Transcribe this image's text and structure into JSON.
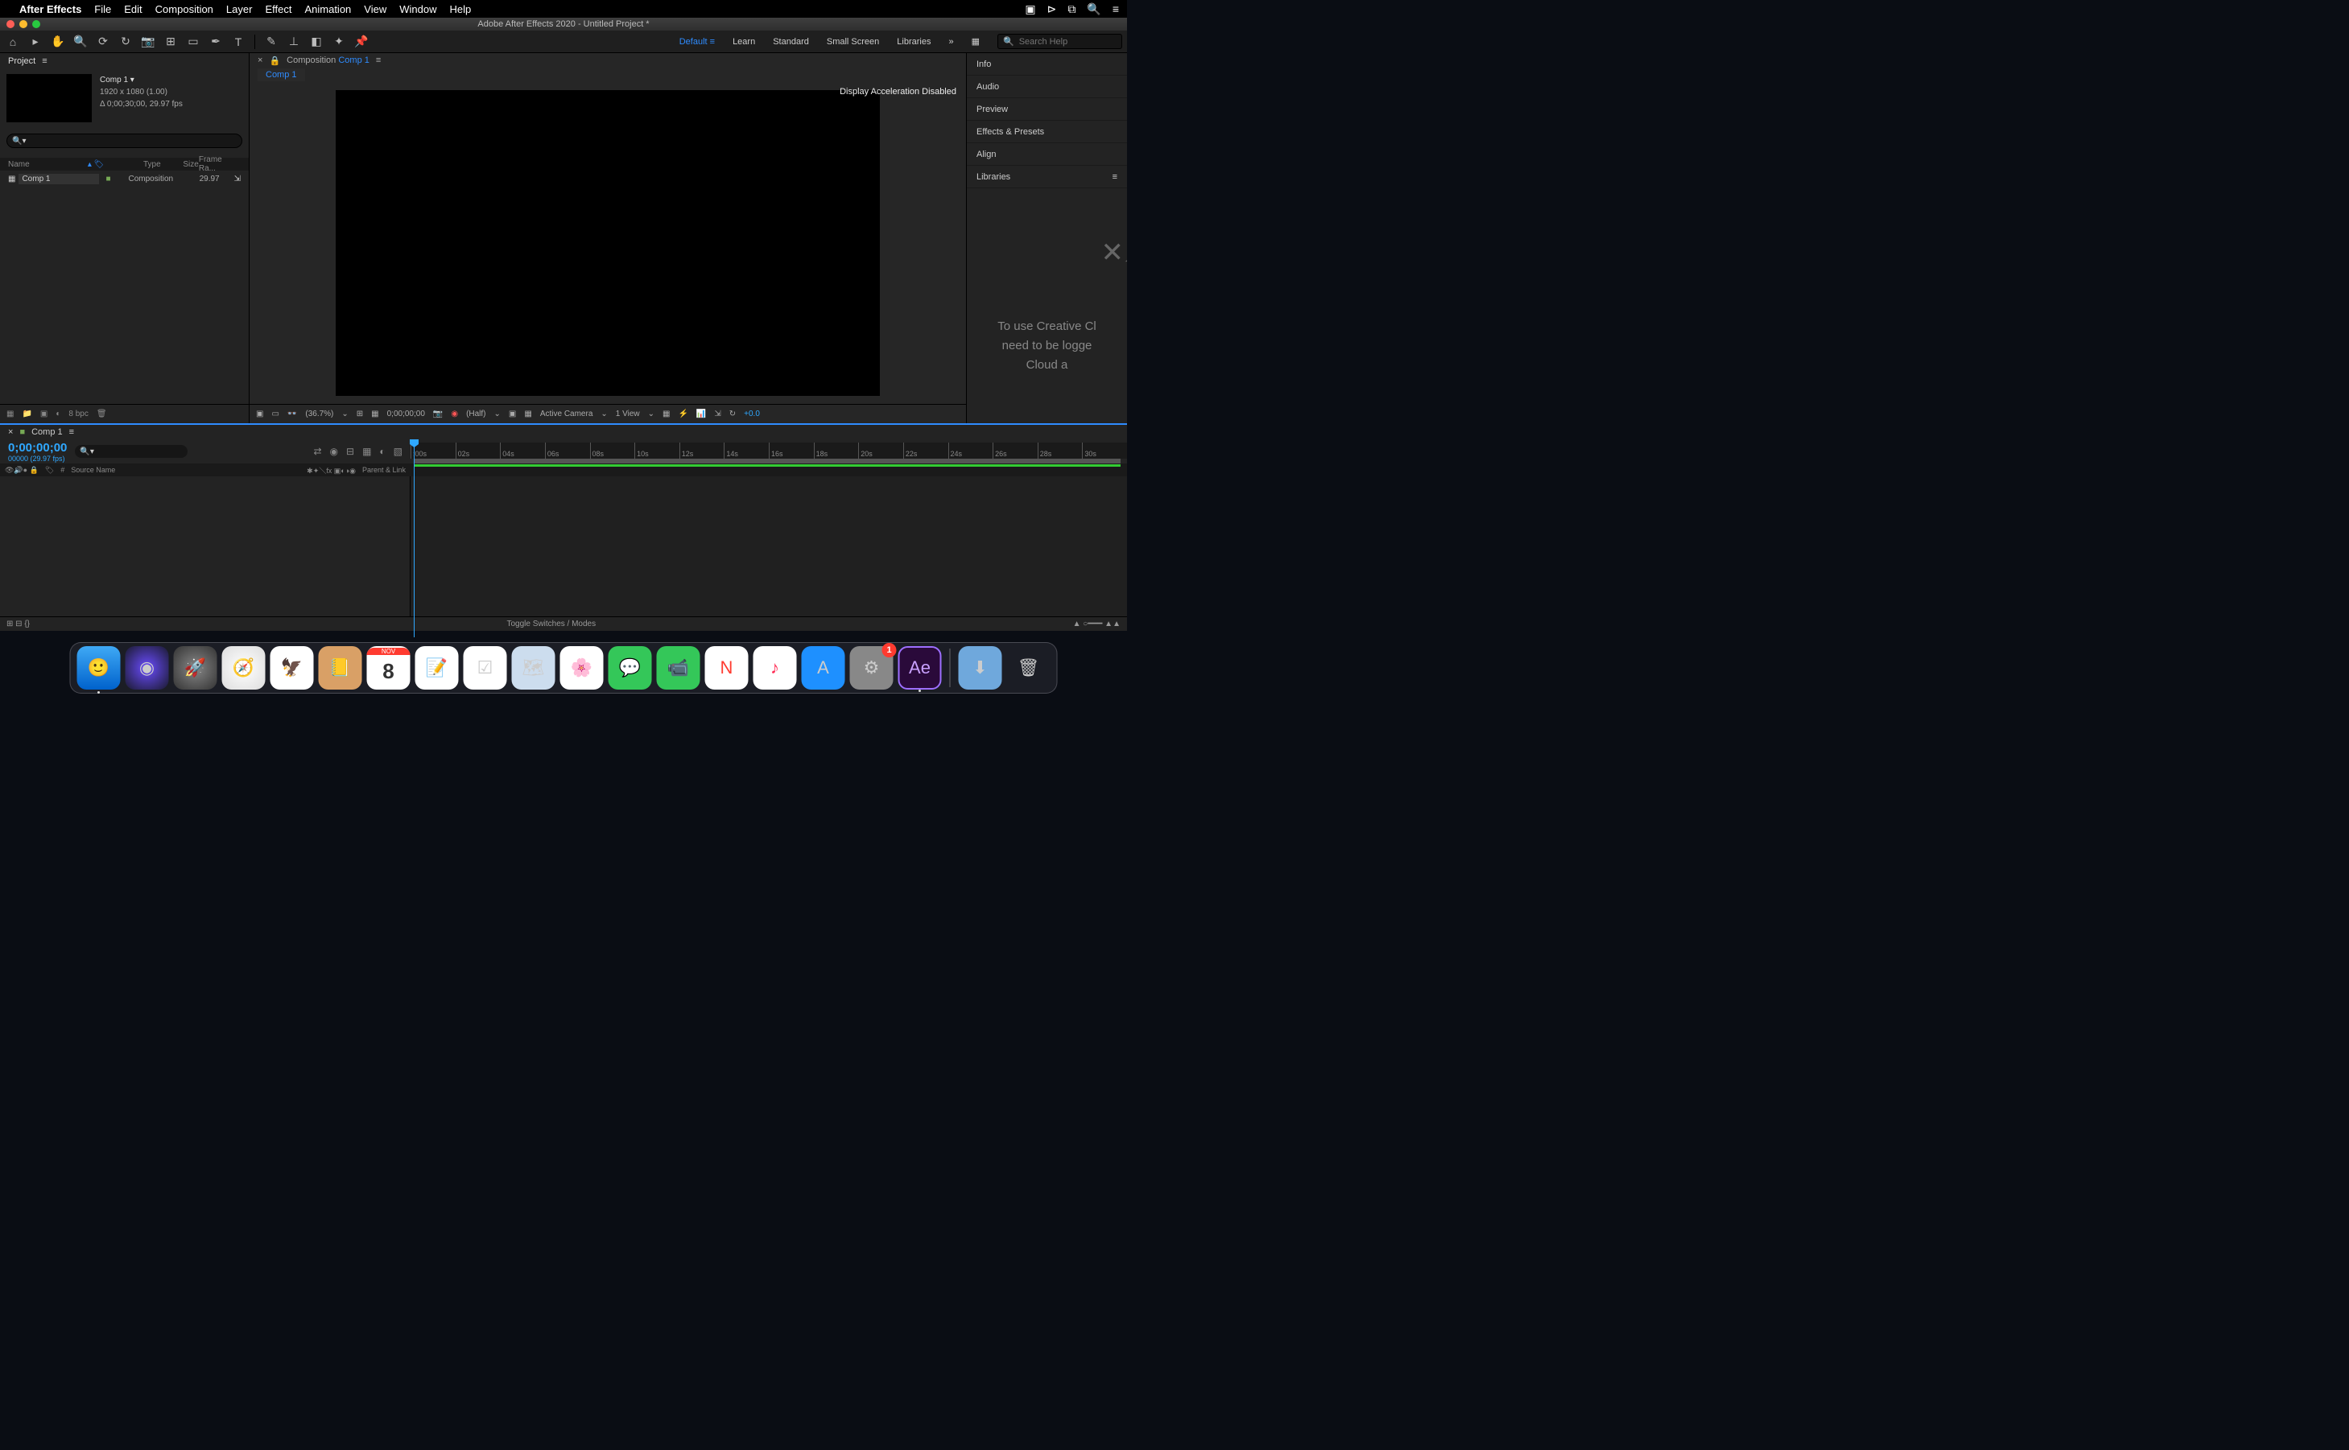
{
  "menubar": {
    "app": "After Effects",
    "items": [
      "File",
      "Edit",
      "Composition",
      "Layer",
      "Effect",
      "Animation",
      "View",
      "Window",
      "Help"
    ]
  },
  "window": {
    "title": "Adobe After Effects 2020 - Untitled Project *"
  },
  "workspaces": {
    "active": "Default",
    "items": [
      "Learn",
      "Standard",
      "Small Screen",
      "Libraries"
    ],
    "search_placeholder": "Search Help"
  },
  "project": {
    "panel_title": "Project",
    "comp_name": "Comp 1",
    "resolution": "1920 x 1080 (1.00)",
    "duration_fps": "Δ 0;00;30;00, 29.97 fps",
    "columns": {
      "name": "Name",
      "type": "Type",
      "size": "Size",
      "fr": "Frame Ra..."
    },
    "row": {
      "name": "Comp 1",
      "type": "Composition",
      "framerate": "29.97"
    },
    "footer_bpc": "8 bpc"
  },
  "composition": {
    "tab_prefix": "Composition",
    "tab_name": "Comp 1",
    "display_msg": "Display Acceleration Disabled",
    "zoom": "(36.7%)",
    "timecode": "0;00;00;00",
    "resolution_label": "(Half)",
    "camera": "Active Camera",
    "view": "1 View",
    "exposure": "+0.0"
  },
  "right_panels": [
    "Info",
    "Audio",
    "Preview",
    "Effects & Presets",
    "Align",
    "Libraries"
  ],
  "libraries_msg": [
    "To use Creative Cl",
    "need to be logge",
    "Cloud a"
  ],
  "timeline": {
    "tab": "Comp 1",
    "timecode": "0;00;00;00",
    "sub": "00000 (29.97 fps)",
    "cols": {
      "num": "#",
      "source": "Source Name",
      "parent": "Parent & Link"
    },
    "ticks": [
      ":00s",
      "02s",
      "04s",
      "06s",
      "08s",
      "10s",
      "12s",
      "14s",
      "16s",
      "18s",
      "20s",
      "22s",
      "24s",
      "26s",
      "28s",
      "30s"
    ],
    "footer": "Toggle Switches / Modes"
  },
  "dock": {
    "apps": [
      {
        "name": "finder",
        "bg": "linear-gradient(#3fa9f5,#0062cc)",
        "glyph": "🙂",
        "running": true
      },
      {
        "name": "siri",
        "bg": "radial-gradient(circle,#6a4cff,#1a1a2e)",
        "glyph": "◉"
      },
      {
        "name": "launchpad",
        "bg": "radial-gradient(circle,#888,#333)",
        "glyph": "🚀"
      },
      {
        "name": "safari",
        "bg": "radial-gradient(circle,#fff,#ddd)",
        "glyph": "🧭"
      },
      {
        "name": "mail",
        "bg": "#fff",
        "glyph": "🦅"
      },
      {
        "name": "contacts",
        "bg": "#d9a066",
        "glyph": "📒"
      },
      {
        "name": "calendar",
        "bg": "#fff",
        "glyph": "8",
        "text": "#333",
        "top": "NOV"
      },
      {
        "name": "notes",
        "bg": "#fff",
        "glyph": "📝"
      },
      {
        "name": "reminders",
        "bg": "#fff",
        "glyph": "☑"
      },
      {
        "name": "maps",
        "bg": "#cde",
        "glyph": "🗺"
      },
      {
        "name": "photos",
        "bg": "#fff",
        "glyph": "🌸"
      },
      {
        "name": "messages",
        "bg": "#34c759",
        "glyph": "💬"
      },
      {
        "name": "facetime",
        "bg": "#34c759",
        "glyph": "📹"
      },
      {
        "name": "news",
        "bg": "#fff",
        "glyph": "N",
        "text": "#ff3b30"
      },
      {
        "name": "music",
        "bg": "#fff",
        "glyph": "♪",
        "text": "#ff2d55"
      },
      {
        "name": "appstore",
        "bg": "#1e90ff",
        "glyph": "A"
      },
      {
        "name": "system-preferences",
        "bg": "#888",
        "glyph": "⚙",
        "badge": "1"
      },
      {
        "name": "after-effects",
        "bg": "#2a0a3a",
        "glyph": "Ae",
        "text": "#c9a0ff",
        "running": true,
        "border": "2px solid #9d6fff"
      }
    ],
    "right": [
      {
        "name": "downloads",
        "bg": "#6fa8dc",
        "glyph": "⬇"
      },
      {
        "name": "trash",
        "bg": "transparent",
        "glyph": "🗑"
      }
    ]
  }
}
